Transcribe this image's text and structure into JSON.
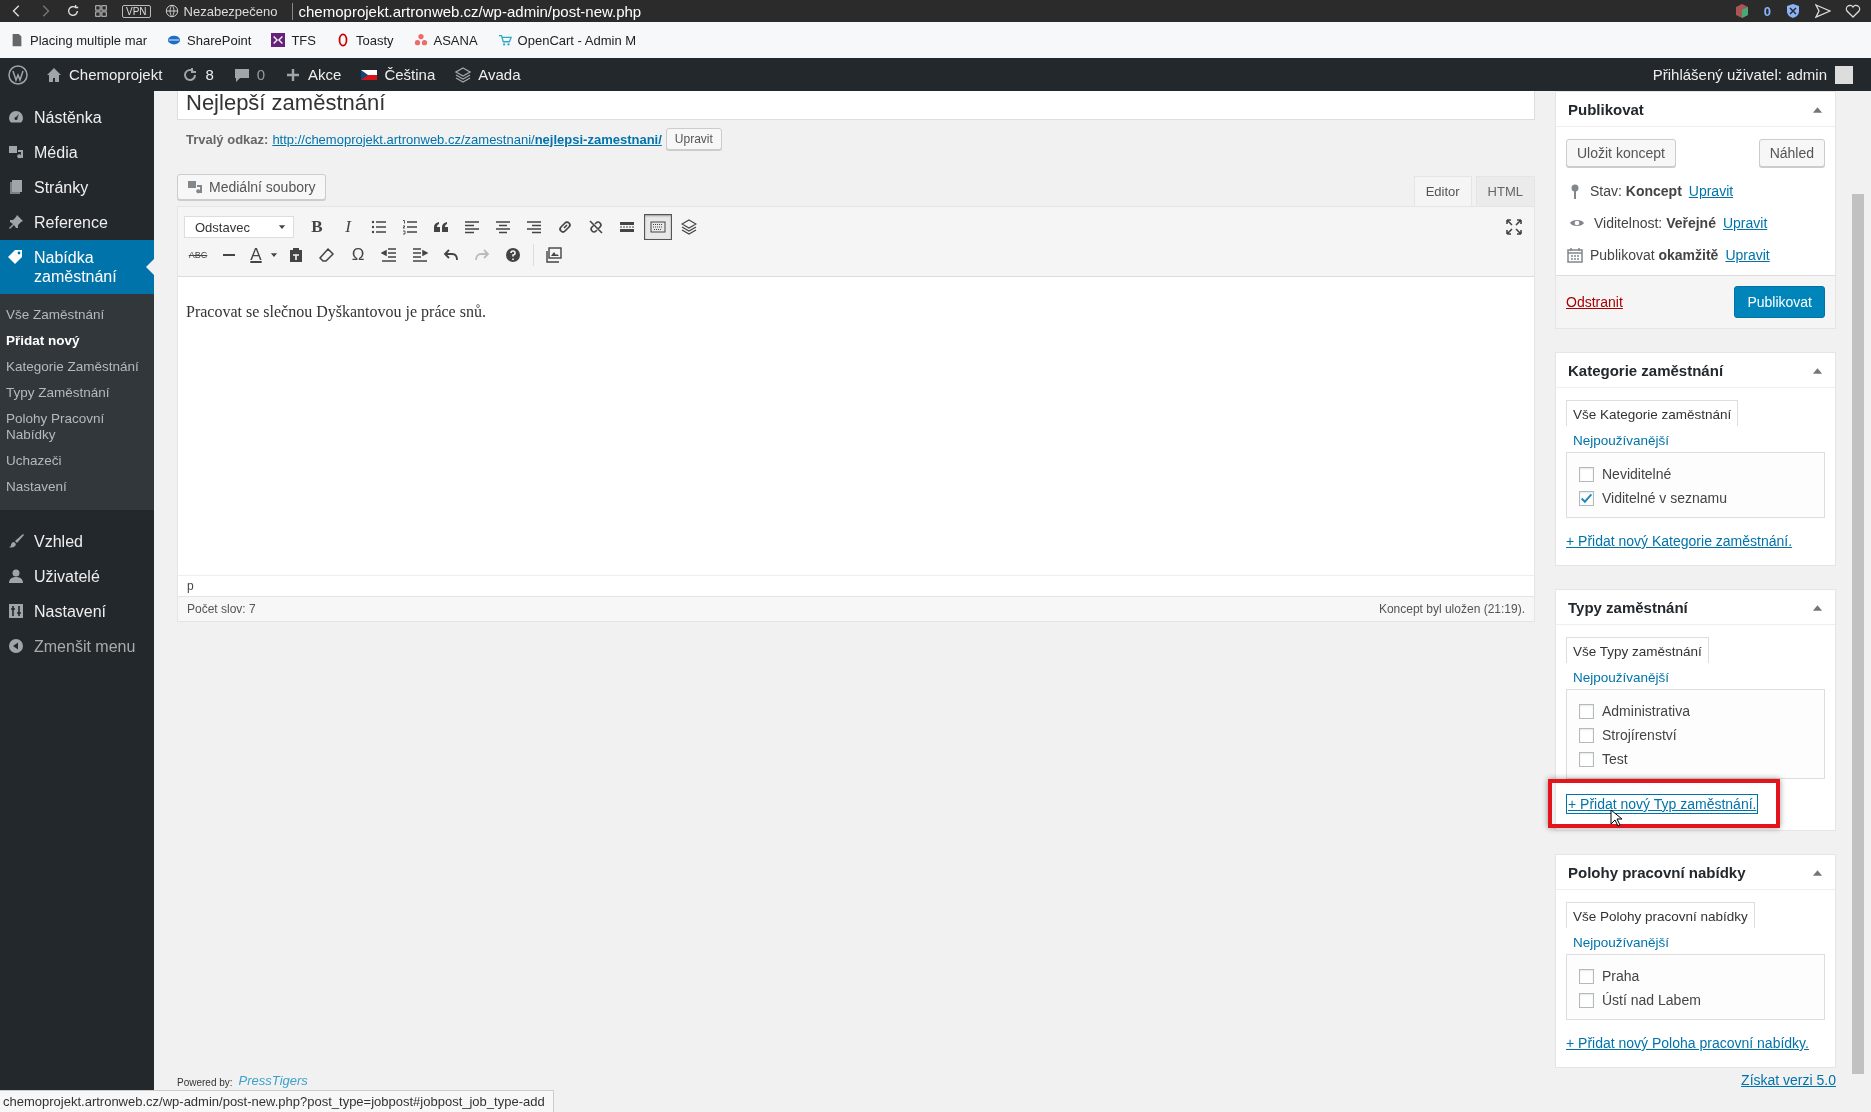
{
  "browser": {
    "vpn": "VPN",
    "security": "Nezabezpečeno",
    "url": "chemoprojekt.artronweb.cz/wp-admin/post-new.php",
    "extension_count": "0"
  },
  "bookmarks": [
    {
      "label": "Placing multiple mar"
    },
    {
      "label": "SharePoint"
    },
    {
      "label": "TFS"
    },
    {
      "label": "Toasty"
    },
    {
      "label": "ASANA"
    },
    {
      "label": "OpenCart - Admin M"
    }
  ],
  "admin_bar": {
    "site": "Chemoprojekt",
    "updates": "8",
    "comments": "0",
    "new": "Akce",
    "language": "Čeština",
    "theme": "Avada",
    "greeting": "Přihlášený uživatel: admin"
  },
  "sidebar": {
    "items": [
      {
        "label": "Nástěnka",
        "selected": false
      },
      {
        "label": "Média",
        "selected": false
      },
      {
        "label": "Stránky",
        "selected": false
      },
      {
        "label": "Reference",
        "selected": false
      },
      {
        "label": "Nabídka zaměstnání",
        "selected": true,
        "children": [
          {
            "label": "Vše Zaměstnání",
            "selected": false
          },
          {
            "label": "Přidat nový",
            "selected": true
          },
          {
            "label": "Kategorie Zaměstnání",
            "selected": false
          },
          {
            "label": "Typy Zaměstnání",
            "selected": false
          },
          {
            "label": "Polohy Pracovní Nabídky",
            "selected": false
          },
          {
            "label": "Uchazeči",
            "selected": false
          },
          {
            "label": "Nastavení",
            "selected": false
          }
        ]
      },
      {
        "label": "Vzhled",
        "selected": false
      },
      {
        "label": "Uživatelé",
        "selected": false
      },
      {
        "label": "Nastavení",
        "selected": false
      },
      {
        "label": "Zmenšit menu",
        "selected": false,
        "kind": "collapse"
      }
    ]
  },
  "editor": {
    "title": "Nejlepší zaměstnání",
    "permalink_label": "Trvalý odkaz:",
    "permalink": "http://chemoprojekt.artronweb.cz/zamestnani/**nejlepsi-zamestnani/**",
    "permalink_edit": "Upravit",
    "media_button": "Mediální soubory",
    "tabs": [
      {
        "label": "Editor",
        "selected": true
      },
      {
        "label": "HTML",
        "selected": false
      }
    ],
    "format": "Odstavec",
    "glyphs": {
      "bold": "B",
      "italic": "I",
      "strike": "ABC",
      "text_color": "A",
      "special": "Ω"
    },
    "toolbar_toggle_on": true,
    "content": "Pracovat se slečnou Dyškantovou je práce snů.",
    "path": "p",
    "word_count": "Počet slov: 7",
    "saved": "Koncept byl uložen (21:19)."
  },
  "publish": {
    "title": "Publikovat",
    "save_draft": "Uložit koncept",
    "preview": "Náhled",
    "rows": [
      {
        "text": "Stav: **Koncept**",
        "link": "Upravit"
      },
      {
        "text": "Viditelnost: **Veřejné**",
        "link": "Upravit"
      },
      {
        "text": "Publikovat **okamžitě**",
        "link": "Upravit"
      }
    ],
    "delete": "Odstranit",
    "publish_button": "Publikovat"
  },
  "taxonomies": [
    {
      "title": "Kategorie zaměstnání",
      "tabs": [
        {
          "label": "Vše Kategorie zaměstnání",
          "selected": true
        },
        {
          "label": "Nejpoužívanější",
          "selected": false
        }
      ],
      "items": [
        {
          "label": "Neviditelné",
          "checked": false
        },
        {
          "label": "Viditelné v seznamu",
          "checked": true
        }
      ],
      "add_link": {
        "text": "+ Přidat nový Kategorie zaměstnání.",
        "highlighted": false
      }
    },
    {
      "title": "Typy zaměstnání",
      "tabs": [
        {
          "label": "Vše Typy zaměstnání",
          "selected": true
        },
        {
          "label": "Nejpoužívanější",
          "selected": false
        }
      ],
      "items": [
        {
          "label": "Administrativa",
          "checked": false
        },
        {
          "label": "Strojírenství",
          "checked": false
        },
        {
          "label": "Test",
          "checked": false
        }
      ],
      "add_link": {
        "text": "+ Přidat nový Typ zaměstnání.",
        "highlighted": true
      }
    },
    {
      "title": "Polohy pracovní nabídky",
      "tabs": [
        {
          "label": "Vše Polohy pracovní nabídky",
          "selected": true
        },
        {
          "label": "Nejpoužívanější",
          "selected": false
        }
      ],
      "items": [
        {
          "label": "Praha",
          "checked": false
        },
        {
          "label": "Ústí nad Labem",
          "checked": false
        }
      ],
      "add_link": {
        "text": "+ Přidat nový Poloha pracovní nabídky.",
        "highlighted": false
      }
    }
  ],
  "footer": {
    "powered_by": "Powered by:",
    "brand": "PressTigers",
    "version_link": "Získat verzi 5.0"
  },
  "status_url": "chemoprojekt.artronweb.cz/wp-admin/post-new.php?post_type=jobpost#jobpost_job_type-add"
}
